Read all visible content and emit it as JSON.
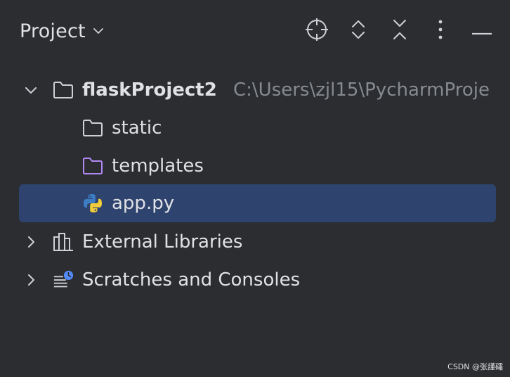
{
  "header": {
    "title": "Project"
  },
  "tree": [
    {
      "label": "flaskProject2",
      "path": "C:\\Users\\zjl15\\PycharmProje",
      "expanded": true,
      "icon": "folder-icon"
    },
    {
      "label": "static",
      "icon": "folder-icon"
    },
    {
      "label": "templates",
      "icon": "templates-folder-icon",
      "icon_color": "#b189f5"
    },
    {
      "label": "app.py",
      "icon": "python-file-icon",
      "selected": true
    },
    {
      "label": "External Libraries",
      "expanded": false,
      "icon": "library-icon"
    },
    {
      "label": "Scratches and Consoles",
      "expanded": false,
      "icon": "scratches-icon"
    }
  ],
  "colors": {
    "background": "#2b2d30",
    "selection": "#2e436e",
    "text": "#dfe1e5",
    "muted_text": "#868a91",
    "icon_gray": "#ced0d6",
    "templates_purple": "#b189f5",
    "python_blue": "#3d7dc4",
    "python_yellow": "#f2cb3a",
    "clock_blue": "#548af7"
  },
  "watermark": "CSDN @张謹礵"
}
